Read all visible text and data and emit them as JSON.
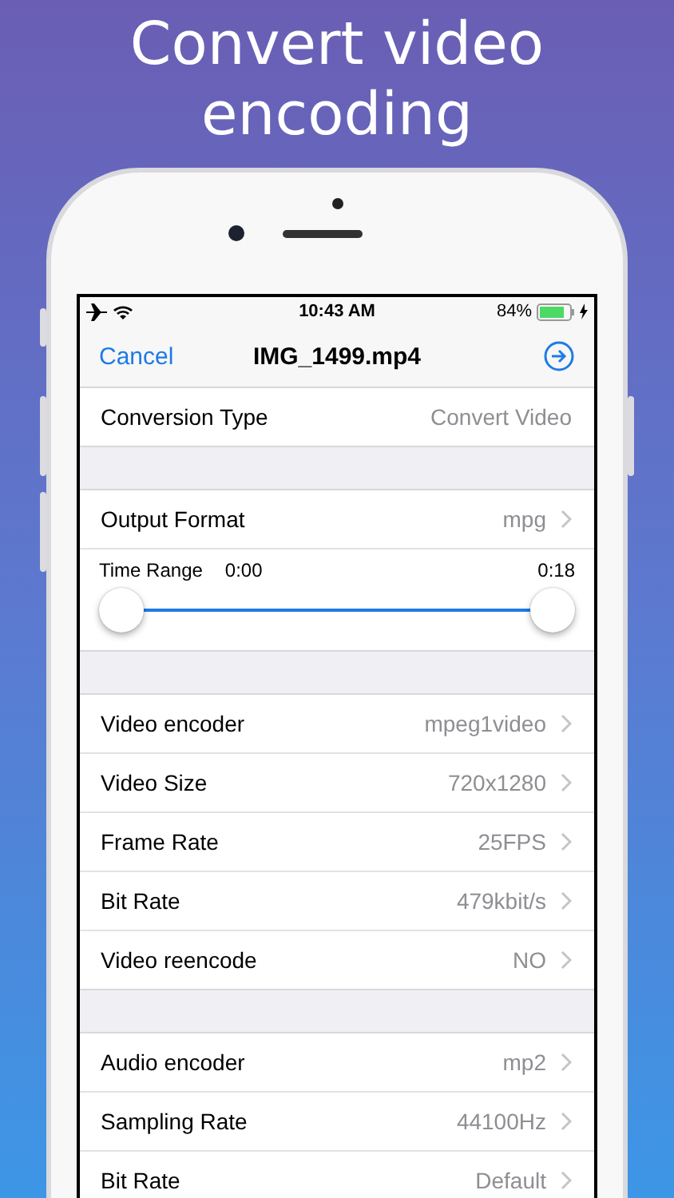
{
  "headline": [
    "Convert video",
    "encoding"
  ],
  "status_bar": {
    "time": "10:43 AM",
    "battery": "84%"
  },
  "nav": {
    "cancel": "Cancel",
    "title": "IMG_1499.mp4"
  },
  "sections": [
    {
      "rows": [
        {
          "kind": "value",
          "label": "Conversion Type",
          "value": "Convert Video",
          "chevron": false
        }
      ]
    },
    {
      "rows": [
        {
          "kind": "value",
          "label": "Output Format",
          "value": "mpg",
          "chevron": true
        },
        {
          "kind": "range",
          "label": "Time Range",
          "start": "0:00",
          "end": "0:18",
          "handles": [
            {
              "level": 0
            },
            {
              "level": 1
            }
          ]
        }
      ]
    },
    {
      "rows": [
        {
          "kind": "value",
          "label": "Video encoder",
          "value": "mpeg1video",
          "chevron": true
        },
        {
          "kind": "value",
          "label": "Video Size",
          "value": "720x1280",
          "chevron": true
        },
        {
          "kind": "value",
          "label": "Frame Rate",
          "value": "25FPS",
          "chevron": true
        },
        {
          "kind": "value",
          "label": "Bit Rate",
          "value": "479kbit/s",
          "chevron": true
        },
        {
          "kind": "value",
          "label": "Video reencode",
          "value": "NO",
          "chevron": true
        }
      ]
    },
    {
      "rows": [
        {
          "kind": "value",
          "label": "Audio encoder",
          "value": "mp2",
          "chevron": true
        },
        {
          "kind": "value",
          "label": "Sampling Rate",
          "value": "44100Hz",
          "chevron": true
        },
        {
          "kind": "value",
          "label": "Bit Rate",
          "value": "Default",
          "chevron": true
        }
      ]
    }
  ]
}
